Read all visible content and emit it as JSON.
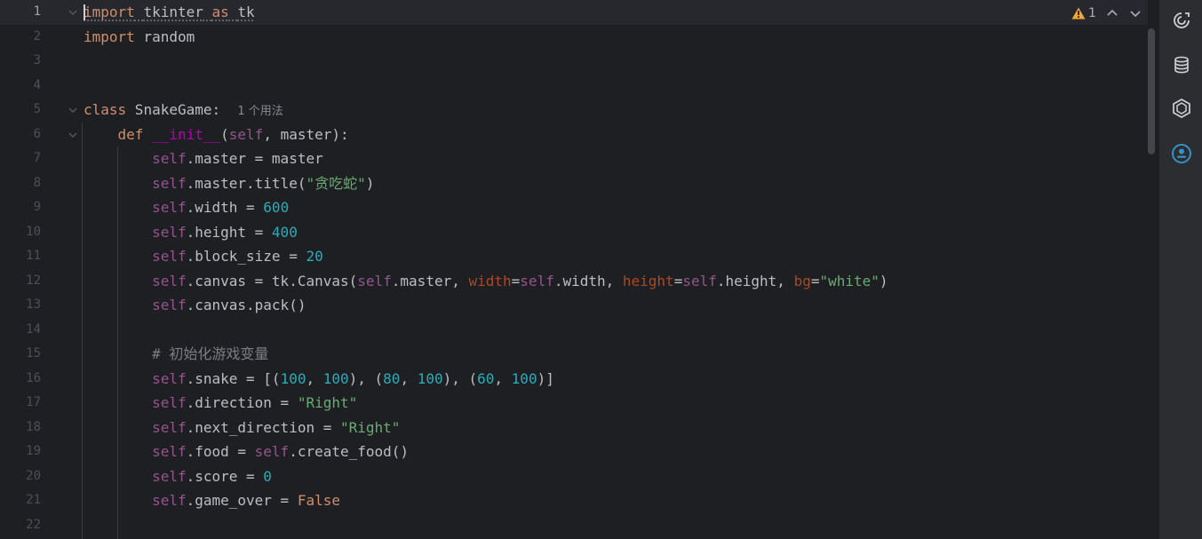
{
  "editor": {
    "inspections": {
      "warning_count": "1"
    },
    "hint": "1 个用法",
    "lines": [
      {
        "n": "1"
      },
      {
        "n": "2"
      },
      {
        "n": "3"
      },
      {
        "n": "4"
      },
      {
        "n": "5"
      },
      {
        "n": "6"
      },
      {
        "n": "7"
      },
      {
        "n": "8"
      },
      {
        "n": "9"
      },
      {
        "n": "10"
      },
      {
        "n": "11"
      },
      {
        "n": "12"
      },
      {
        "n": "13"
      },
      {
        "n": "14"
      },
      {
        "n": "15"
      },
      {
        "n": "16"
      },
      {
        "n": "17"
      },
      {
        "n": "18"
      },
      {
        "n": "19"
      },
      {
        "n": "20"
      },
      {
        "n": "21"
      },
      {
        "n": "22"
      }
    ],
    "tokens": {
      "l1": [
        "import",
        " ",
        "tkinter",
        " ",
        "as",
        " ",
        "tk"
      ],
      "l2": [
        "import",
        " random"
      ],
      "l5": [
        "class",
        " SnakeGame:  "
      ],
      "l6": [
        "def",
        " ",
        "__init__",
        "(",
        "self",
        ", master):"
      ],
      "l7": [
        "self",
        ".master = master"
      ],
      "l8": [
        "self",
        ".master.title(",
        "\"贪吃蛇\"",
        ")"
      ],
      "l9": [
        "self",
        ".width = ",
        "600"
      ],
      "l10": [
        "self",
        ".height = ",
        "400"
      ],
      "l11": [
        "self",
        ".block_size = ",
        "20"
      ],
      "l12": [
        "self",
        ".canvas = tk.Canvas(",
        "self",
        ".master, ",
        "width",
        "=",
        "self",
        ".width, ",
        "height",
        "=",
        "self",
        ".height, ",
        "bg",
        "=",
        "\"white\"",
        ")"
      ],
      "l13": [
        "self",
        ".canvas.pack()"
      ],
      "l15": [
        "# 初始化游戏变量"
      ],
      "l16": [
        "self",
        ".snake = [(",
        "100",
        ", ",
        "100",
        "), (",
        "80",
        ", ",
        "100",
        "), (",
        "60",
        ", ",
        "100",
        ")]"
      ],
      "l17": [
        "self",
        ".direction = ",
        "\"Right\""
      ],
      "l18": [
        "self",
        ".next_direction = ",
        "\"Right\""
      ],
      "l19": [
        "self",
        ".food = ",
        "self",
        ".create_food()"
      ],
      "l20": [
        "self",
        ".score = ",
        "0"
      ],
      "l21": [
        "self",
        ".game_over = ",
        "False"
      ]
    }
  },
  "icons": {
    "warning": "warning-triangle-icon",
    "prev": "chevron-up-icon",
    "next": "chevron-down-icon",
    "ai": "ai-assistant-icon",
    "db": "database-icon",
    "plugin": "hexagon-plugin-icon",
    "account": "account-icon"
  },
  "colors": {
    "background": "#1e1f22",
    "keyword": "#cf8e6d",
    "self": "#94558d",
    "number": "#2aacb8",
    "string": "#6aab73",
    "comment": "#7a7e85",
    "dunder": "#b200b2",
    "named_param": "#aa4926",
    "accent": "#3592c4"
  }
}
